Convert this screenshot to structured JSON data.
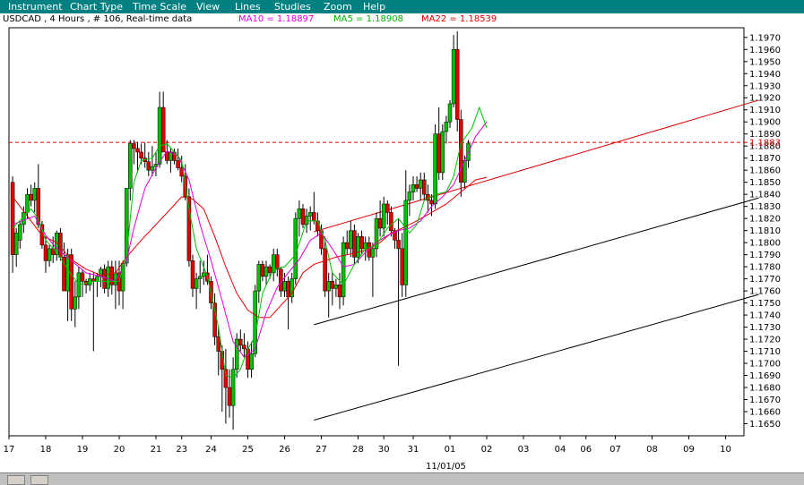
{
  "menu": [
    "Instrument",
    "Chart Type",
    "Time Scale",
    "View",
    "Lines",
    "Studies",
    "Zoom",
    "Help"
  ],
  "legend": {
    "instrument": "USDCAD , 4 Hours , # 106, Real-time data",
    "ma10": "MA10 = 1.18897",
    "ma5": "MA5 = 1.18908",
    "ma22": "MA22 = 1.18539"
  },
  "colors": {
    "ma10": "#e000e0",
    "ma5": "#00c000",
    "ma22": "#e00000",
    "up": "#00c000",
    "down": "#e00000",
    "trendline": "#e00000",
    "channel": "#000000",
    "level_line": "#e00000"
  },
  "current_level_label": "1.1883",
  "date_label": "11/01/05",
  "chart_data": {
    "type": "candlestick",
    "y_range": [
      1.164,
      1.1978
    ],
    "price_ticks": [
      "1.1970",
      "1.1960",
      "1.1950",
      "1.1940",
      "1.1930",
      "1.1920",
      "1.1910",
      "1.1900",
      "1.1890",
      "1.1880",
      "1.1870",
      "1.1860",
      "1.1850",
      "1.1840",
      "1.1830",
      "1.1820",
      "1.1810",
      "1.1800",
      "1.1790",
      "1.1780",
      "1.1770",
      "1.1760",
      "1.1750",
      "1.1740",
      "1.1730",
      "1.1720",
      "1.1710",
      "1.1700",
      "1.1690",
      "1.1680",
      "1.1670",
      "1.1660",
      "1.1650"
    ],
    "x_range": [
      0,
      200
    ],
    "date_ticks": [
      {
        "label": "17",
        "x": 0
      },
      {
        "label": "18",
        "x": 10
      },
      {
        "label": "19",
        "x": 20
      },
      {
        "label": "20",
        "x": 30
      },
      {
        "label": "21",
        "x": 40
      },
      {
        "label": "23",
        "x": 47
      },
      {
        "label": "24",
        "x": 55
      },
      {
        "label": "25",
        "x": 65
      },
      {
        "label": "26",
        "x": 75
      },
      {
        "label": "27",
        "x": 85
      },
      {
        "label": "28",
        "x": 95
      },
      {
        "label": "30",
        "x": 102
      },
      {
        "label": "31",
        "x": 110
      },
      {
        "label": "01",
        "x": 120
      },
      {
        "label": "02",
        "x": 130
      },
      {
        "label": "03",
        "x": 140
      },
      {
        "label": "04",
        "x": 150
      },
      {
        "label": "06",
        "x": 157
      },
      {
        "label": "07",
        "x": 165
      },
      {
        "label": "08",
        "x": 175
      },
      {
        "label": "09",
        "x": 185
      },
      {
        "label": "10",
        "x": 195
      }
    ],
    "candles": [
      [
        1.185,
        1.1855,
        1.1775,
        1.179
      ],
      [
        1.179,
        1.1812,
        1.178,
        1.1808
      ],
      [
        1.1802,
        1.1818,
        1.1795,
        1.1815
      ],
      [
        1.1815,
        1.183,
        1.1808,
        1.1825
      ],
      [
        1.1825,
        1.1845,
        1.182,
        1.184
      ],
      [
        1.184,
        1.1848,
        1.183,
        1.1835
      ],
      [
        1.1835,
        1.185,
        1.1825,
        1.1845
      ],
      [
        1.1845,
        1.1865,
        1.1812,
        1.1815
      ],
      [
        1.1815,
        1.1818,
        1.1795,
        1.1798
      ],
      [
        1.1798,
        1.1805,
        1.1775,
        1.1785
      ],
      [
        1.1785,
        1.1798,
        1.178,
        1.1795
      ],
      [
        1.1795,
        1.1805,
        1.1783,
        1.179
      ],
      [
        1.179,
        1.181,
        1.1785,
        1.1808
      ],
      [
        1.1808,
        1.1812,
        1.1785,
        1.1788
      ],
      [
        1.1788,
        1.18,
        1.177,
        1.176
      ],
      [
        1.176,
        1.1795,
        1.1735,
        1.179
      ],
      [
        1.179,
        1.1795,
        1.1735,
        1.1745
      ],
      [
        1.1745,
        1.1768,
        1.173,
        1.1755
      ],
      [
        1.1755,
        1.178,
        1.1745,
        1.1775
      ],
      [
        1.1775,
        1.1778,
        1.1755,
        1.1768
      ],
      [
        1.1768,
        1.177,
        1.1758,
        1.1765
      ],
      [
        1.1765,
        1.1775,
        1.176,
        1.177
      ],
      [
        1.177,
        1.1775,
        1.171,
        1.1768
      ],
      [
        1.1768,
        1.1775,
        1.1755,
        1.1772
      ],
      [
        1.1772,
        1.178,
        1.1763,
        1.1778
      ],
      [
        1.1778,
        1.1782,
        1.1758,
        1.1762
      ],
      [
        1.1762,
        1.1785,
        1.1755,
        1.178
      ],
      [
        1.178,
        1.1785,
        1.1757,
        1.1765
      ],
      [
        1.1765,
        1.1785,
        1.1745,
        1.1775
      ],
      [
        1.1775,
        1.1785,
        1.1748,
        1.176
      ],
      [
        1.176,
        1.1785,
        1.1745,
        1.1783
      ],
      [
        1.1783,
        1.1845,
        1.178,
        1.1845
      ],
      [
        1.1845,
        1.1885,
        1.1835,
        1.1882
      ],
      [
        1.1882,
        1.1885,
        1.1865,
        1.1878
      ],
      [
        1.1878,
        1.1883,
        1.1858,
        1.1875
      ],
      [
        1.1875,
        1.1882,
        1.1865,
        1.187
      ],
      [
        1.187,
        1.1883,
        1.1862,
        1.1867
      ],
      [
        1.1867,
        1.1875,
        1.1855,
        1.186
      ],
      [
        1.186,
        1.188,
        1.1855,
        1.1863
      ],
      [
        1.1863,
        1.1875,
        1.1855,
        1.1865
      ],
      [
        1.1865,
        1.1925,
        1.1862,
        1.1912
      ],
      [
        1.1912,
        1.1925,
        1.1875,
        1.1875
      ],
      [
        1.1875,
        1.1885,
        1.1865,
        1.1868
      ],
      [
        1.1868,
        1.1878,
        1.1858,
        1.1875
      ],
      [
        1.1875,
        1.1878,
        1.1865,
        1.1868
      ],
      [
        1.1868,
        1.1878,
        1.186,
        1.1862
      ],
      [
        1.1862,
        1.1872,
        1.185,
        1.1855
      ],
      [
        1.1855,
        1.1865,
        1.1835,
        1.1838
      ],
      [
        1.1838,
        1.1845,
        1.178,
        1.1785
      ],
      [
        1.1785,
        1.179,
        1.1755,
        1.1762
      ],
      [
        1.1762,
        1.1775,
        1.1745,
        1.177
      ],
      [
        1.177,
        1.1785,
        1.1758,
        1.1772
      ],
      [
        1.1772,
        1.1785,
        1.1765,
        1.1775
      ],
      [
        1.1775,
        1.179,
        1.1765,
        1.1768
      ],
      [
        1.1768,
        1.1772,
        1.1745,
        1.175
      ],
      [
        1.175,
        1.1758,
        1.1715,
        1.1722
      ],
      [
        1.1722,
        1.173,
        1.169,
        1.171
      ],
      [
        1.171,
        1.1715,
        1.166,
        1.1695
      ],
      [
        1.1695,
        1.1712,
        1.165,
        1.168
      ],
      [
        1.168,
        1.1695,
        1.1655,
        1.1665
      ],
      [
        1.1665,
        1.1705,
        1.1645,
        1.1695
      ],
      [
        1.1695,
        1.1725,
        1.1688,
        1.172
      ],
      [
        1.172,
        1.1728,
        1.171,
        1.1715
      ],
      [
        1.1715,
        1.1725,
        1.1705,
        1.1712
      ],
      [
        1.1712,
        1.1718,
        1.1688,
        1.1695
      ],
      [
        1.1695,
        1.1718,
        1.1688,
        1.1708
      ],
      [
        1.1708,
        1.1765,
        1.1705,
        1.176
      ],
      [
        1.176,
        1.1785,
        1.175,
        1.1782
      ],
      [
        1.1782,
        1.1785,
        1.1768,
        1.1772
      ],
      [
        1.1772,
        1.1785,
        1.1765,
        1.178
      ],
      [
        1.178,
        1.1782,
        1.177,
        1.1775
      ],
      [
        1.1775,
        1.1795,
        1.1768,
        1.179
      ],
      [
        1.179,
        1.1795,
        1.1772,
        1.1778
      ],
      [
        1.1778,
        1.178,
        1.1755,
        1.176
      ],
      [
        1.176,
        1.1775,
        1.1755,
        1.1768
      ],
      [
        1.1768,
        1.1772,
        1.1728,
        1.1755
      ],
      [
        1.1755,
        1.1775,
        1.175,
        1.177
      ],
      [
        1.177,
        1.1825,
        1.1765,
        1.182
      ],
      [
        1.182,
        1.1835,
        1.1805,
        1.1828
      ],
      [
        1.1828,
        1.1832,
        1.1812,
        1.1815
      ],
      [
        1.1815,
        1.1828,
        1.1808,
        1.1822
      ],
      [
        1.1822,
        1.183,
        1.181,
        1.1825
      ],
      [
        1.1825,
        1.1842,
        1.1815,
        1.1818
      ],
      [
        1.1818,
        1.1825,
        1.1805,
        1.181
      ],
      [
        1.181,
        1.1815,
        1.179,
        1.1795
      ],
      [
        1.1795,
        1.1805,
        1.1755,
        1.176
      ],
      [
        1.176,
        1.1775,
        1.1738,
        1.1768
      ],
      [
        1.1768,
        1.1775,
        1.1748,
        1.1762
      ],
      [
        1.1762,
        1.177,
        1.1755,
        1.1765
      ],
      [
        1.1765,
        1.1775,
        1.1745,
        1.1755
      ],
      [
        1.1755,
        1.1805,
        1.1748,
        1.18
      ],
      [
        1.18,
        1.181,
        1.179,
        1.1795
      ],
      [
        1.1795,
        1.1818,
        1.1788,
        1.181
      ],
      [
        1.181,
        1.1815,
        1.1782,
        1.1788
      ],
      [
        1.1788,
        1.1808,
        1.1783,
        1.1805
      ],
      [
        1.1805,
        1.181,
        1.179,
        1.1795
      ],
      [
        1.1795,
        1.1805,
        1.1785,
        1.18
      ],
      [
        1.18,
        1.1805,
        1.1785,
        1.1788
      ],
      [
        1.1788,
        1.18,
        1.1755,
        1.1795
      ],
      [
        1.1795,
        1.1825,
        1.1788,
        1.182
      ],
      [
        1.182,
        1.1835,
        1.1805,
        1.1812
      ],
      [
        1.1812,
        1.1838,
        1.1805,
        1.1832
      ],
      [
        1.1832,
        1.1835,
        1.1815,
        1.1825
      ],
      [
        1.1825,
        1.183,
        1.1805,
        1.181
      ],
      [
        1.181,
        1.1812,
        1.1795,
        1.1802
      ],
      [
        1.1802,
        1.182,
        1.1698,
        1.1795
      ],
      [
        1.1795,
        1.1808,
        1.1755,
        1.1765
      ],
      [
        1.1765,
        1.186,
        1.1755,
        1.1835
      ],
      [
        1.1835,
        1.1848,
        1.1822,
        1.1842
      ],
      [
        1.1842,
        1.1855,
        1.1835,
        1.1848
      ],
      [
        1.1848,
        1.1855,
        1.1842,
        1.1845
      ],
      [
        1.1845,
        1.1858,
        1.1835,
        1.1852
      ],
      [
        1.1852,
        1.1858,
        1.1835,
        1.184
      ],
      [
        1.184,
        1.1848,
        1.1825,
        1.1835
      ],
      [
        1.1835,
        1.184,
        1.1822,
        1.1832
      ],
      [
        1.1832,
        1.1898,
        1.1828,
        1.189
      ],
      [
        1.189,
        1.1912,
        1.1852,
        1.1858
      ],
      [
        1.1858,
        1.1898,
        1.1852,
        1.1892
      ],
      [
        1.1892,
        1.1905,
        1.1882,
        1.19
      ],
      [
        1.19,
        1.1918,
        1.1895,
        1.1915
      ],
      [
        1.1915,
        1.1972,
        1.1912,
        1.196
      ],
      [
        1.196,
        1.1975,
        1.1892,
        1.1902
      ],
      [
        1.1902,
        1.191,
        1.1838,
        1.185
      ],
      [
        1.185,
        1.1872,
        1.1845,
        1.1868
      ],
      [
        1.1868,
        1.1885,
        1.1862,
        1.1882
      ]
    ],
    "ma5": [
      [
        0,
        1.1812
      ],
      [
        5,
        1.1828
      ],
      [
        7,
        1.182
      ],
      [
        9,
        1.1802
      ],
      [
        12,
        1.1792
      ],
      [
        15,
        1.1778
      ],
      [
        18,
        1.1765
      ],
      [
        22,
        1.1768
      ],
      [
        26,
        1.1768
      ],
      [
        29,
        1.1768
      ],
      [
        31,
        1.179
      ],
      [
        33,
        1.185
      ],
      [
        35,
        1.1868
      ],
      [
        38,
        1.187
      ],
      [
        40,
        1.188
      ],
      [
        42,
        1.1882
      ],
      [
        46,
        1.1868
      ],
      [
        48,
        1.1828
      ],
      [
        50,
        1.1795
      ],
      [
        53,
        1.1772
      ],
      [
        56,
        1.173
      ],
      [
        58,
        1.169
      ],
      [
        60,
        1.1688
      ],
      [
        62,
        1.1695
      ],
      [
        64,
        1.1712
      ],
      [
        66,
        1.1722
      ],
      [
        68,
        1.1758
      ],
      [
        71,
        1.1778
      ],
      [
        74,
        1.178
      ],
      [
        77,
        1.179
      ],
      [
        80,
        1.1818
      ],
      [
        83,
        1.1818
      ],
      [
        85,
        1.1802
      ],
      [
        87,
        1.1775
      ],
      [
        90,
        1.1765
      ],
      [
        93,
        1.1782
      ],
      [
        96,
        1.1795
      ],
      [
        99,
        1.1798
      ],
      [
        102,
        1.1812
      ],
      [
        105,
        1.182
      ],
      [
        108,
        1.1808
      ],
      [
        110,
        1.1815
      ],
      [
        112,
        1.1835
      ],
      [
        115,
        1.184
      ],
      [
        118,
        1.1842
      ],
      [
        120,
        1.1855
      ],
      [
        122,
        1.1882
      ],
      [
        125,
        1.1895
      ],
      [
        127,
        1.1912
      ],
      [
        129,
        1.1895
      ]
    ],
    "ma10": [
      [
        0,
        1.1815
      ],
      [
        6,
        1.1822
      ],
      [
        9,
        1.1806
      ],
      [
        12,
        1.1795
      ],
      [
        16,
        1.1785
      ],
      [
        20,
        1.1775
      ],
      [
        24,
        1.1772
      ],
      [
        28,
        1.1768
      ],
      [
        31,
        1.1785
      ],
      [
        33,
        1.1812
      ],
      [
        36,
        1.1845
      ],
      [
        39,
        1.1862
      ],
      [
        42,
        1.1876
      ],
      [
        45,
        1.1872
      ],
      [
        48,
        1.1852
      ],
      [
        51,
        1.1815
      ],
      [
        54,
        1.1785
      ],
      [
        57,
        1.1752
      ],
      [
        60,
        1.1718
      ],
      [
        63,
        1.1705
      ],
      [
        66,
        1.1712
      ],
      [
        69,
        1.1742
      ],
      [
        72,
        1.1763
      ],
      [
        75,
        1.1775
      ],
      [
        78,
        1.1786
      ],
      [
        81,
        1.1802
      ],
      [
        84,
        1.1808
      ],
      [
        87,
        1.1795
      ],
      [
        90,
        1.178
      ],
      [
        93,
        1.1782
      ],
      [
        96,
        1.1792
      ],
      [
        99,
        1.18
      ],
      [
        102,
        1.1806
      ],
      [
        105,
        1.181
      ],
      [
        108,
        1.1812
      ],
      [
        111,
        1.1818
      ],
      [
        114,
        1.183
      ],
      [
        117,
        1.1838
      ],
      [
        120,
        1.1848
      ],
      [
        123,
        1.1868
      ],
      [
        126,
        1.1888
      ],
      [
        129,
        1.19
      ]
    ],
    "ma22": [
      [
        0,
        1.1838
      ],
      [
        4,
        1.1822
      ],
      [
        8,
        1.1806
      ],
      [
        12,
        1.18
      ],
      [
        16,
        1.1786
      ],
      [
        20,
        1.1778
      ],
      [
        24,
        1.1773
      ],
      [
        28,
        1.1775
      ],
      [
        31,
        1.1788
      ],
      [
        35,
        1.1802
      ],
      [
        39,
        1.1815
      ],
      [
        43,
        1.1828
      ],
      [
        46,
        1.1838
      ],
      [
        49,
        1.1836
      ],
      [
        52,
        1.1828
      ],
      [
        55,
        1.1805
      ],
      [
        58,
        1.178
      ],
      [
        61,
        1.1758
      ],
      [
        64,
        1.1744
      ],
      [
        67,
        1.1738
      ],
      [
        70,
        1.1738
      ],
      [
        73,
        1.1748
      ],
      [
        76,
        1.1758
      ],
      [
        79,
        1.1775
      ],
      [
        82,
        1.1782
      ],
      [
        85,
        1.1785
      ],
      [
        88,
        1.1788
      ],
      [
        91,
        1.179
      ],
      [
        94,
        1.1792
      ],
      [
        97,
        1.1795
      ],
      [
        100,
        1.18
      ],
      [
        103,
        1.1808
      ],
      [
        106,
        1.1812
      ],
      [
        110,
        1.1818
      ],
      [
        114,
        1.1825
      ],
      [
        118,
        1.1832
      ],
      [
        122,
        1.1842
      ],
      [
        126,
        1.1852
      ],
      [
        129,
        1.1854
      ]
    ],
    "trendlines": [
      {
        "kind": "resistance",
        "from": [
          83,
          1.1809
        ],
        "to": [
          204,
          1.1918
        ]
      },
      {
        "kind": "channel_mid",
        "from": [
          83,
          1.1732
        ],
        "to": [
          204,
          1.1837
        ]
      },
      {
        "kind": "channel_low",
        "from": [
          83,
          1.1653
        ],
        "to": [
          204,
          1.1757
        ]
      }
    ],
    "level": 1.1883
  }
}
